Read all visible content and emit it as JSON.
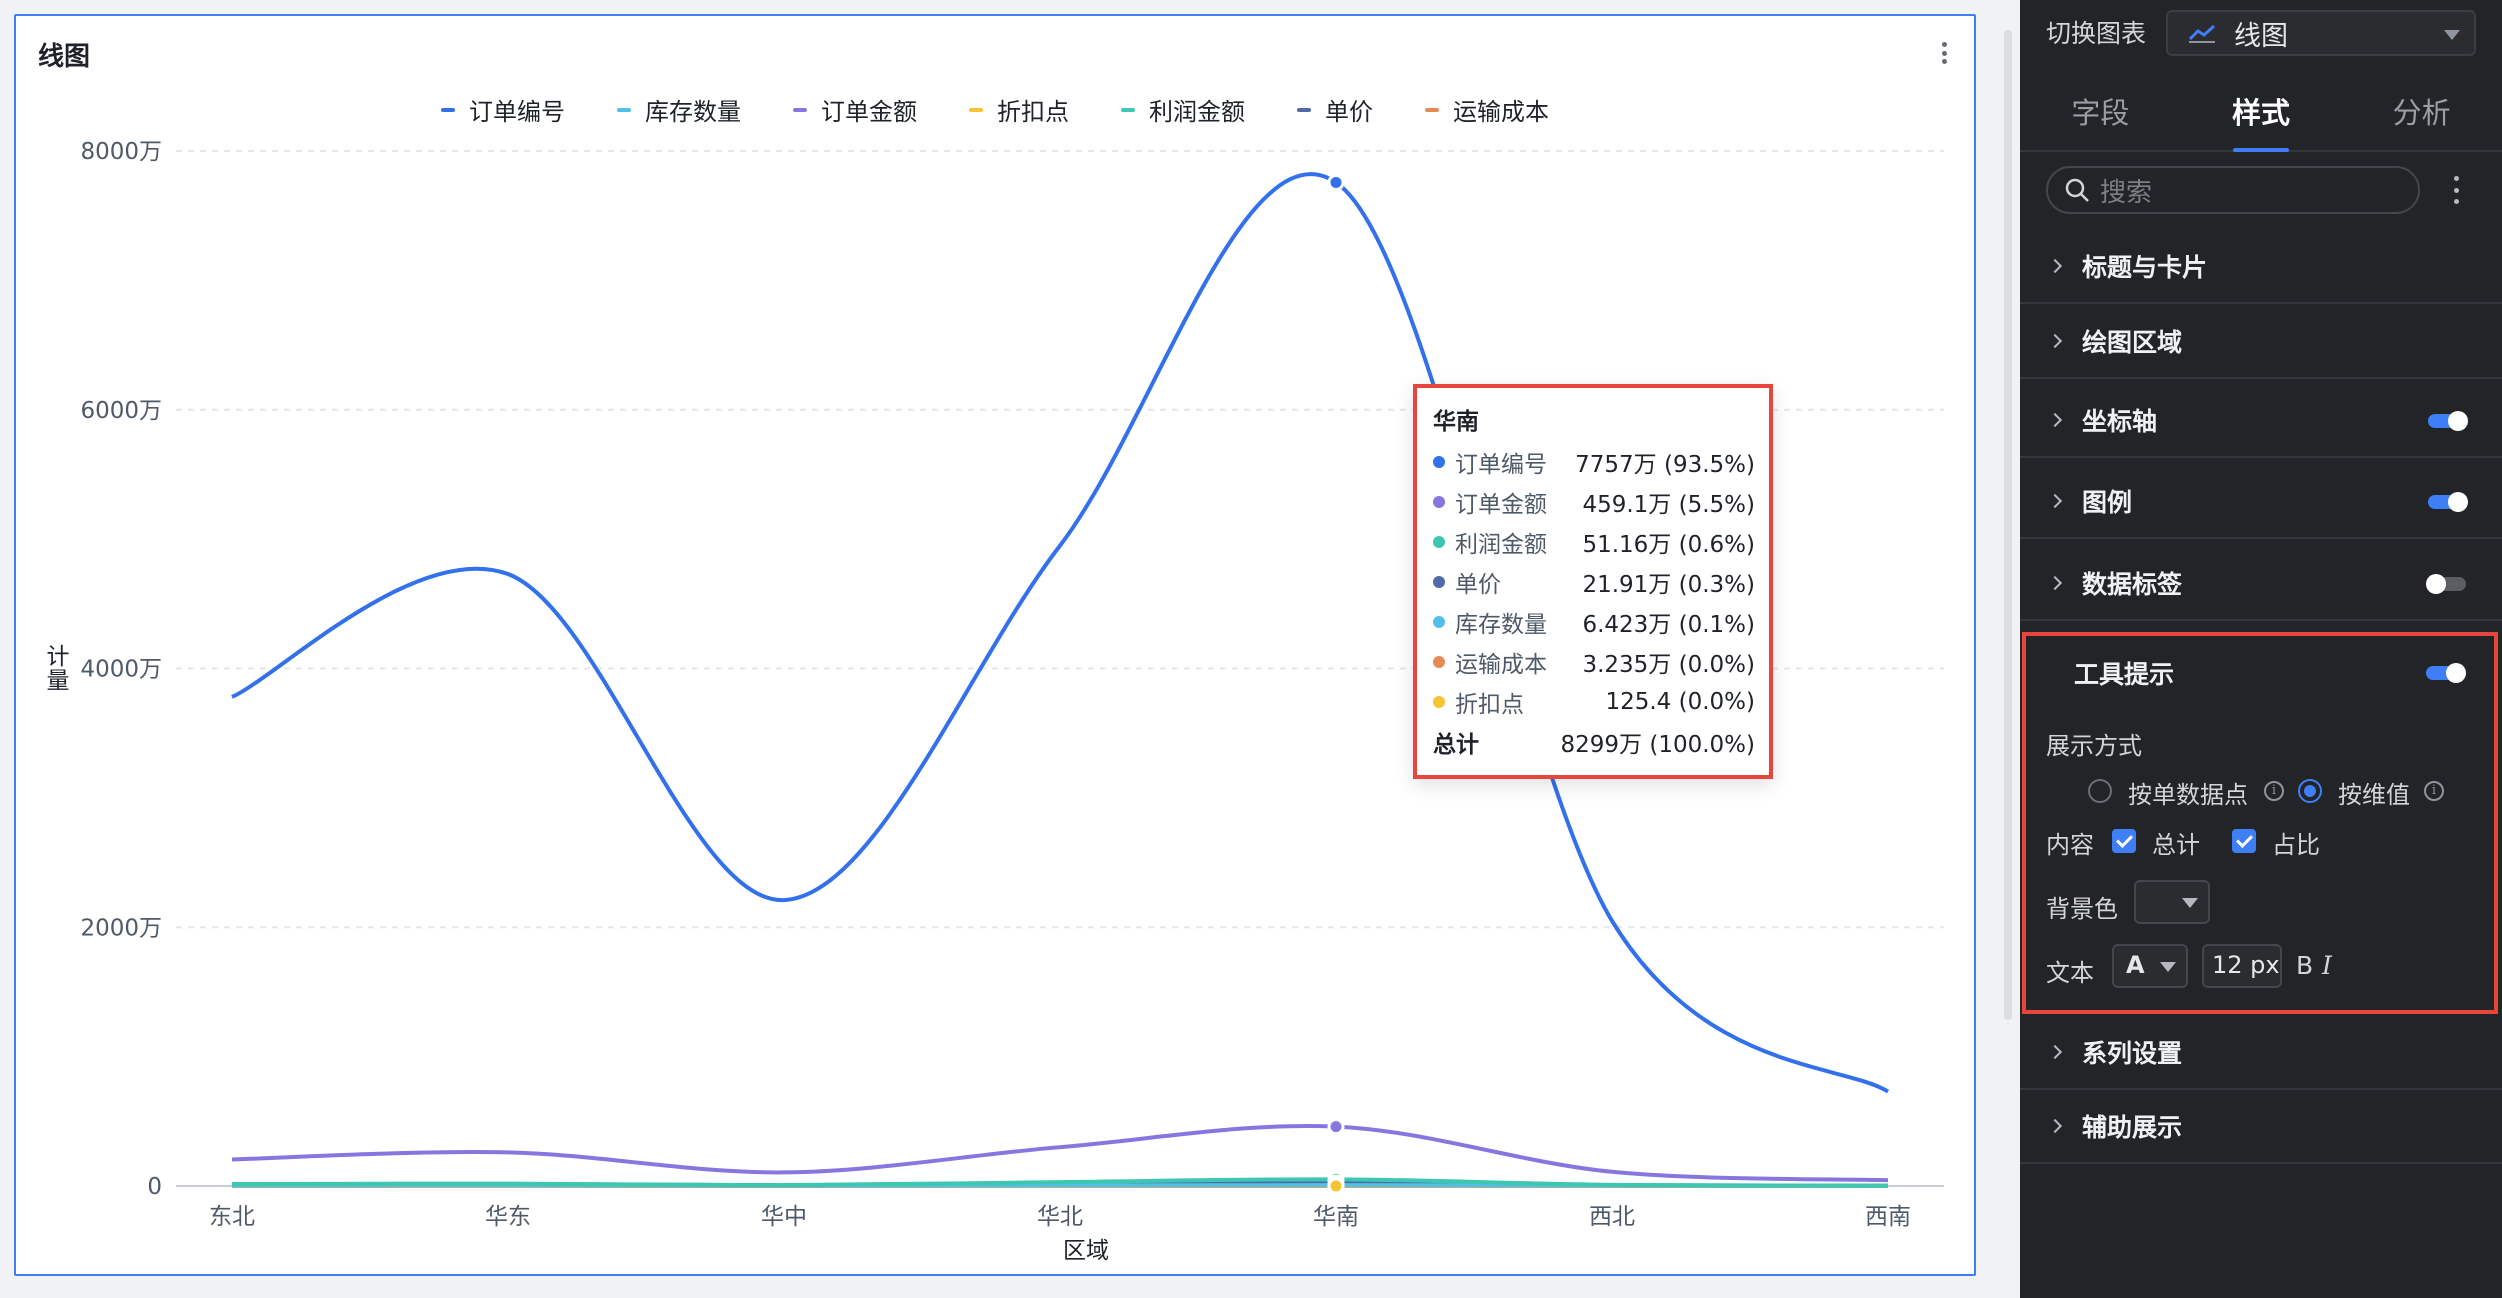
{
  "chart_card": {
    "title": "线图"
  },
  "legend": [
    {
      "name": "订单编号",
      "color": "#3370eb"
    },
    {
      "name": "库存数量",
      "color": "#50c0e8"
    },
    {
      "name": "订单金额",
      "color": "#8776e0"
    },
    {
      "name": "折扣点",
      "color": "#f5c431"
    },
    {
      "name": "利润金额",
      "color": "#3ec7b0"
    },
    {
      "name": "单价",
      "color": "#4f6ba8"
    },
    {
      "name": "运输成本",
      "color": "#e68b55"
    }
  ],
  "chart_data": {
    "type": "line",
    "categories": [
      "东北",
      "华东",
      "华中",
      "华北",
      "华南",
      "西北",
      "西南"
    ],
    "xlabel": "区域",
    "ylabel": "计量",
    "ylim": [
      0,
      80000000
    ],
    "yticks": [
      "0",
      "2000万",
      "4000万",
      "6000万",
      "8000万"
    ],
    "grid": true,
    "legend_position": "top",
    "series": [
      {
        "name": "订单编号",
        "color": "#3370eb",
        "values": [
          37800000,
          47300000,
          22100000,
          49500000,
          77570000,
          20500000,
          7300000
        ]
      },
      {
        "name": "订单金额",
        "color": "#8776e0",
        "values": [
          2050000,
          2600000,
          1050000,
          3000000,
          4591000,
          1100000,
          450000
        ]
      },
      {
        "name": "利润金额",
        "color": "#3ec7b0",
        "values": [
          150000,
          180000,
          70000,
          300000,
          511600,
          90000,
          40000
        ]
      },
      {
        "name": "库存数量",
        "color": "#50c0e8",
        "values": [
          40000,
          50000,
          25000,
          45000,
          64230,
          30000,
          10000
        ]
      },
      {
        "name": "单价",
        "color": "#4f6ba8",
        "values": [
          120000,
          150000,
          60000,
          180000,
          219100,
          70000,
          30000
        ]
      },
      {
        "name": "运输成本",
        "color": "#e68b55",
        "values": [
          20000,
          25000,
          10000,
          28000,
          32350,
          15000,
          6000
        ]
      },
      {
        "name": "折扣点",
        "color": "#f5c431",
        "values": [
          90,
          110,
          50,
          100,
          125.4,
          60,
          25
        ]
      }
    ],
    "highlight_category": "华南"
  },
  "tooltip": {
    "title": "华南",
    "rows": [
      {
        "name": "订单编号",
        "value": "7757万 (93.5%)",
        "color": "#3370eb"
      },
      {
        "name": "订单金额",
        "value": "459.1万 (5.5%)",
        "color": "#8776e0"
      },
      {
        "name": "利润金额",
        "value": "51.16万 (0.6%)",
        "color": "#3ec7b0"
      },
      {
        "name": "单价",
        "value": "21.91万 (0.3%)",
        "color": "#4f6ba8"
      },
      {
        "name": "库存数量",
        "value": "6.423万 (0.1%)",
        "color": "#50c0e8"
      },
      {
        "name": "运输成本",
        "value": "3.235万 (0.0%)",
        "color": "#e68b55"
      },
      {
        "name": "折扣点",
        "value": "125.4 (0.0%)",
        "color": "#f5c431"
      }
    ],
    "total_label": "总计",
    "total_value": "8299万 (100.0%)"
  },
  "panel": {
    "switch_label": "切换图表",
    "chart_type": "线图",
    "tabs": [
      "字段",
      "样式",
      "分析"
    ],
    "active_tab": "样式",
    "search_placeholder": "搜索",
    "sections": {
      "title_card": "标题与卡片",
      "plot_area": "绘图区域",
      "axis": "坐标轴",
      "legend": "图例",
      "data_label": "数据标签",
      "tooltip": "工具提示",
      "series": "系列设置",
      "aux": "辅助展示"
    },
    "tooltip_opts": {
      "display_mode_label": "展示方式",
      "mode_single": "按单数据点",
      "mode_dim": "按维值",
      "content_label": "内容",
      "total": "总计",
      "ratio": "占比",
      "bg_label": "背景色",
      "text_label": "文本",
      "font_color": "A",
      "font_size": "12 px",
      "bold": "B",
      "italic": "I"
    }
  }
}
